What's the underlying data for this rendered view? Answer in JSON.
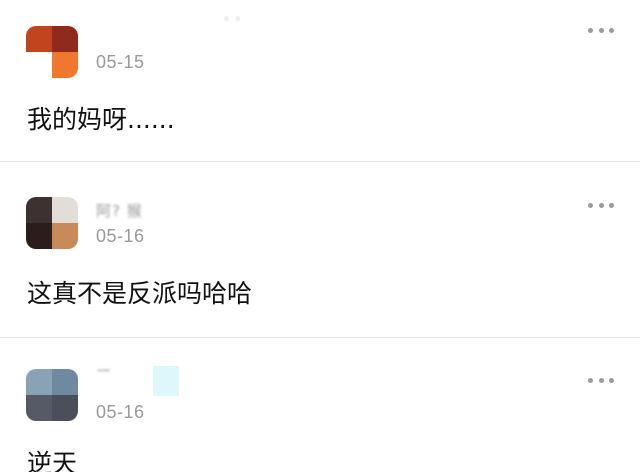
{
  "comments": [
    {
      "username": "· ·",
      "timestamp": "05-15",
      "content": "我的妈呀......",
      "avatar_colors": [
        "#c0451f",
        "#8e2b1c",
        "#ffffff",
        "#f0782e"
      ]
    },
    {
      "username": "阿? 猴",
      "timestamp": "05-16",
      "content": "这真不是反派吗哈哈",
      "avatar_colors": [
        "#3d3231",
        "#e2ddd6",
        "#2a1d1c",
        "#c98a59"
      ]
    },
    {
      "username": "ー",
      "timestamp": "05-16",
      "content": "逆天",
      "avatar_colors": [
        "#8aa2b5",
        "#6f8aa0",
        "#565a66",
        "#4a4f5a"
      ]
    }
  ],
  "icons": {
    "more": "more-horizontal-icon"
  },
  "colors": {
    "text": "#111111",
    "meta": "#9a9a9a",
    "divider": "#e6e6e6"
  }
}
